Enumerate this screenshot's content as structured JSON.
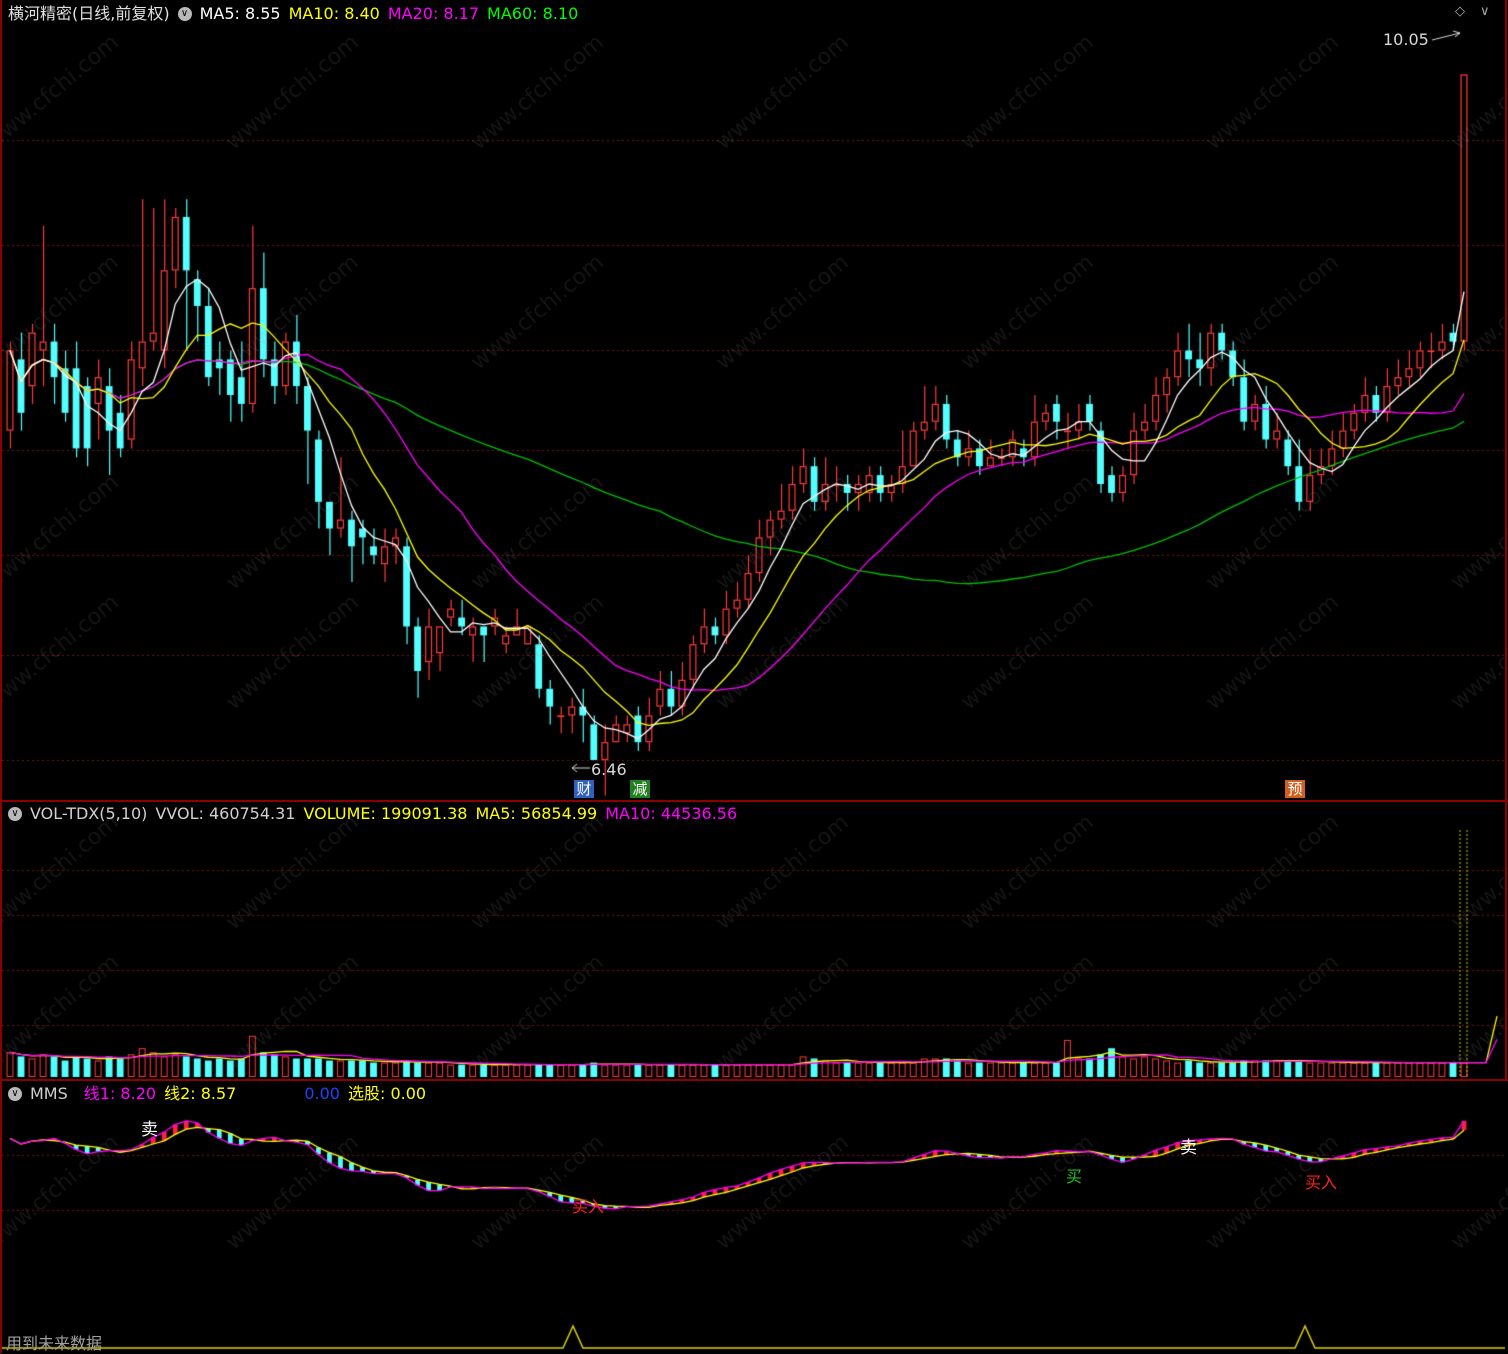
{
  "main_panel": {
    "title": "横河精密(日线,前复权)",
    "indicators": [
      {
        "label": "MA5: 8.55",
        "color": "#ffffff"
      },
      {
        "label": "MA10: 8.40",
        "color": "#ffff00"
      },
      {
        "label": "MA20: 8.17",
        "color": "#ff00ff"
      },
      {
        "label": "MA60: 8.10",
        "color": "#00ff00"
      }
    ],
    "high_label": "10.05",
    "low_label": "6.46",
    "badges": [
      {
        "text": "财",
        "bg": "#3060c0"
      },
      {
        "text": "减",
        "bg": "#208020"
      },
      {
        "text": "预",
        "bg": "#d06020"
      }
    ]
  },
  "vol_panel": {
    "name": "VOL-TDX(5,10)",
    "items": [
      {
        "label": "VVOL: 460754.31",
        "color": "#d0d0d0"
      },
      {
        "label": "VOLUME: 199091.38",
        "color": "#ffff00"
      },
      {
        "label": "MA5: 56854.99",
        "color": "#ffff00"
      },
      {
        "label": "MA10: 44536.56",
        "color": "#ff00ff"
      }
    ]
  },
  "mms_panel": {
    "name": "MMS",
    "items": [
      {
        "label": "线1: 8.20",
        "color": "#ff00ff"
      },
      {
        "label": "线2: 8.57",
        "color": "#ffff00"
      },
      {
        "label": "0.00",
        "color": "#0000ff"
      },
      {
        "label": "选股: 0.00",
        "color": "#ffff00"
      }
    ],
    "sell_label": "卖",
    "buy_label": "买入",
    "buy_short": "买",
    "footer": "用到未来数据"
  },
  "watermark": "www.cfchi.com",
  "colors": {
    "up": "#ff3b3b",
    "down": "#54ffff",
    "ma5": "#ffffff",
    "ma10": "#ffff00",
    "ma20": "#ff00ff",
    "ma60": "#00c000",
    "border": "#8b0000",
    "grid": "#7a1010"
  },
  "chart_data": {
    "type": "candlestick",
    "ylim": [
      6.2,
      10.3
    ],
    "candles": [
      [
        8.05,
        8.5,
        8.55,
        7.95
      ],
      [
        8.45,
        8.15,
        8.6,
        8.05
      ],
      [
        8.3,
        8.6,
        8.65,
        8.2
      ],
      [
        8.5,
        8.55,
        9.2,
        8.3
      ],
      [
        8.55,
        8.35,
        8.65,
        8.2
      ],
      [
        8.4,
        8.15,
        8.5,
        8.1
      ],
      [
        8.4,
        7.95,
        8.55,
        7.9
      ],
      [
        8.3,
        7.95,
        8.35,
        7.85
      ],
      [
        8.2,
        8.35,
        8.45,
        8.0
      ],
      [
        8.3,
        8.05,
        8.4,
        7.8
      ],
      [
        8.15,
        7.95,
        8.25,
        7.9
      ],
      [
        8.0,
        8.45,
        8.55,
        7.95
      ],
      [
        8.4,
        8.55,
        9.35,
        8.3
      ],
      [
        8.55,
        8.6,
        9.3,
        8.5
      ],
      [
        8.5,
        8.95,
        9.35,
        8.4
      ],
      [
        8.95,
        9.25,
        9.3,
        8.85
      ],
      [
        9.25,
        8.95,
        9.35,
        8.5
      ],
      [
        8.9,
        8.75,
        8.95,
        8.55
      ],
      [
        8.75,
        8.35,
        8.85,
        8.3
      ],
      [
        8.45,
        8.4,
        8.55,
        8.25
      ],
      [
        8.45,
        8.25,
        8.5,
        8.1
      ],
      [
        8.35,
        8.2,
        8.55,
        8.1
      ],
      [
        8.2,
        8.85,
        9.2,
        8.15
      ],
      [
        8.85,
        8.45,
        9.05,
        8.35
      ],
      [
        8.45,
        8.3,
        8.55,
        8.2
      ],
      [
        8.3,
        8.55,
        8.6,
        8.25
      ],
      [
        8.55,
        8.3,
        8.7,
        8.2
      ],
      [
        8.3,
        8.05,
        8.35,
        7.75
      ],
      [
        8.0,
        7.65,
        8.05,
        7.5
      ],
      [
        7.65,
        7.5,
        7.65,
        7.35
      ],
      [
        7.5,
        7.55,
        7.9,
        7.45
      ],
      [
        7.55,
        7.4,
        7.6,
        7.2
      ],
      [
        7.5,
        7.45,
        7.55,
        7.3
      ],
      [
        7.4,
        7.35,
        7.5,
        7.3
      ],
      [
        7.3,
        7.4,
        7.5,
        7.2
      ],
      [
        7.4,
        7.45,
        7.5,
        7.3
      ],
      [
        7.4,
        6.95,
        7.45,
        6.85
      ],
      [
        6.95,
        6.7,
        7.0,
        6.55
      ],
      [
        6.75,
        6.95,
        7.05,
        6.65
      ],
      [
        6.8,
        6.95,
        6.95,
        6.7
      ],
      [
        7.0,
        7.05,
        7.1,
        6.95
      ],
      [
        7.0,
        6.95,
        7.1,
        6.9
      ],
      [
        6.9,
        6.95,
        7.0,
        6.75
      ],
      [
        6.95,
        6.9,
        6.95,
        6.75
      ],
      [
        6.95,
        7.0,
        7.05,
        6.9
      ],
      [
        6.85,
        6.9,
        6.95,
        6.8
      ],
      [
        6.9,
        6.95,
        7.05,
        6.9
      ],
      [
        6.85,
        6.95,
        6.95,
        6.85
      ],
      [
        6.85,
        6.6,
        6.9,
        6.55
      ],
      [
        6.6,
        6.5,
        6.65,
        6.4
      ],
      [
        6.45,
        6.45,
        6.5,
        6.35
      ],
      [
        6.45,
        6.5,
        6.55,
        6.35
      ],
      [
        6.5,
        6.45,
        6.6,
        6.3
      ],
      [
        6.4,
        6.2,
        6.45,
        6.2
      ],
      [
        6.2,
        6.3,
        6.4,
        6.0
      ],
      [
        6.3,
        6.4,
        6.45,
        6.3
      ],
      [
        6.35,
        6.4,
        6.45,
        6.3
      ],
      [
        6.45,
        6.3,
        6.5,
        6.25
      ],
      [
        6.3,
        6.45,
        6.55,
        6.25
      ],
      [
        6.5,
        6.6,
        6.7,
        6.45
      ],
      [
        6.6,
        6.5,
        6.7,
        6.45
      ],
      [
        6.5,
        6.65,
        6.75,
        6.45
      ],
      [
        6.65,
        6.85,
        6.9,
        6.6
      ],
      [
        6.85,
        6.95,
        7.05,
        6.8
      ],
      [
        6.95,
        6.9,
        7.0,
        6.85
      ],
      [
        6.9,
        7.05,
        7.15,
        6.85
      ],
      [
        7.05,
        7.1,
        7.2,
        7.0
      ],
      [
        7.1,
        7.25,
        7.35,
        7.05
      ],
      [
        7.25,
        7.45,
        7.55,
        7.2
      ],
      [
        7.45,
        7.55,
        7.6,
        7.35
      ],
      [
        7.55,
        7.6,
        7.75,
        7.5
      ],
      [
        7.6,
        7.75,
        7.85,
        7.55
      ],
      [
        7.75,
        7.85,
        7.95,
        7.7
      ],
      [
        7.85,
        7.65,
        7.9,
        7.6
      ],
      [
        7.65,
        7.75,
        7.9,
        7.6
      ],
      [
        7.75,
        7.75,
        7.85,
        7.65
      ],
      [
        7.75,
        7.7,
        7.8,
        7.6
      ],
      [
        7.7,
        7.75,
        7.8,
        7.6
      ],
      [
        7.7,
        7.8,
        7.85,
        7.65
      ],
      [
        7.8,
        7.7,
        7.85,
        7.65
      ],
      [
        7.7,
        7.75,
        7.8,
        7.65
      ],
      [
        7.75,
        7.85,
        8.05,
        7.7
      ],
      [
        7.85,
        8.05,
        8.1,
        7.85
      ],
      [
        8.05,
        8.1,
        8.3,
        8.0
      ],
      [
        8.1,
        8.2,
        8.3,
        8.05
      ],
      [
        8.2,
        8.0,
        8.25,
        7.95
      ],
      [
        8.0,
        7.9,
        8.05,
        7.85
      ],
      [
        7.9,
        7.95,
        8.05,
        7.85
      ],
      [
        7.95,
        7.85,
        8.0,
        7.8
      ],
      [
        7.85,
        7.9,
        8.0,
        7.85
      ],
      [
        7.9,
        7.9,
        7.95,
        7.85
      ],
      [
        7.9,
        8.0,
        8.05,
        7.85
      ],
      [
        7.95,
        7.9,
        8.0,
        7.85
      ],
      [
        7.9,
        8.1,
        8.25,
        7.85
      ],
      [
        8.1,
        8.15,
        8.2,
        8.05
      ],
      [
        8.2,
        8.1,
        8.25,
        8.0
      ],
      [
        8.05,
        8.05,
        8.15,
        7.95
      ],
      [
        8.05,
        8.1,
        8.2,
        8.0
      ],
      [
        8.2,
        8.1,
        8.25,
        8.05
      ],
      [
        8.05,
        7.75,
        8.1,
        7.7
      ],
      [
        7.8,
        7.7,
        7.85,
        7.65
      ],
      [
        7.7,
        7.8,
        7.85,
        7.65
      ],
      [
        7.8,
        8.05,
        8.15,
        7.75
      ],
      [
        8.05,
        8.1,
        8.2,
        8.0
      ],
      [
        8.1,
        8.25,
        8.35,
        8.05
      ],
      [
        8.25,
        8.35,
        8.4,
        8.15
      ],
      [
        8.35,
        8.5,
        8.6,
        8.3
      ],
      [
        8.5,
        8.45,
        8.65,
        8.35
      ],
      [
        8.45,
        8.4,
        8.6,
        8.3
      ],
      [
        8.4,
        8.6,
        8.65,
        8.3
      ],
      [
        8.6,
        8.5,
        8.65,
        8.45
      ],
      [
        8.5,
        8.35,
        8.55,
        8.3
      ],
      [
        8.35,
        8.1,
        8.45,
        8.05
      ],
      [
        8.1,
        8.2,
        8.25,
        8.05
      ],
      [
        8.2,
        8.0,
        8.3,
        7.95
      ],
      [
        8.0,
        8.05,
        8.15,
        7.95
      ],
      [
        8.0,
        7.85,
        8.05,
        7.8
      ],
      [
        7.85,
        7.65,
        8.0,
        7.6
      ],
      [
        7.65,
        7.8,
        7.95,
        7.6
      ],
      [
        7.8,
        7.85,
        7.95,
        7.75
      ],
      [
        7.85,
        7.95,
        8.05,
        7.8
      ],
      [
        7.95,
        8.05,
        8.15,
        7.9
      ],
      [
        8.05,
        8.15,
        8.2,
        8.0
      ],
      [
        8.15,
        8.25,
        8.35,
        8.1
      ],
      [
        8.25,
        8.15,
        8.3,
        8.1
      ],
      [
        8.15,
        8.3,
        8.4,
        8.1
      ],
      [
        8.3,
        8.35,
        8.45,
        8.25
      ],
      [
        8.35,
        8.4,
        8.5,
        8.3
      ],
      [
        8.4,
        8.5,
        8.55,
        8.35
      ],
      [
        8.5,
        8.5,
        8.6,
        8.4
      ],
      [
        8.5,
        8.55,
        8.65,
        8.45
      ],
      [
        8.6,
        8.55,
        8.65,
        8.5
      ],
      [
        8.55,
        10.05,
        10.05,
        8.5
      ]
    ],
    "volume_rel": [
      0.6,
      0.5,
      0.45,
      0.55,
      0.5,
      0.4,
      0.5,
      0.45,
      0.4,
      0.5,
      0.45,
      0.55,
      0.7,
      0.6,
      0.5,
      0.55,
      0.5,
      0.45,
      0.4,
      0.45,
      0.4,
      0.45,
      1.0,
      0.6,
      0.55,
      0.5,
      0.45,
      0.45,
      0.45,
      0.4,
      0.4,
      0.4,
      0.4,
      0.35,
      0.35,
      0.35,
      0.4,
      0.35,
      0.35,
      0.35,
      0.3,
      0.3,
      0.3,
      0.3,
      0.3,
      0.3,
      0.3,
      0.3,
      0.3,
      0.3,
      0.3,
      0.3,
      0.3,
      0.35,
      0.3,
      0.3,
      0.3,
      0.3,
      0.3,
      0.3,
      0.3,
      0.3,
      0.3,
      0.3,
      0.3,
      0.3,
      0.3,
      0.3,
      0.3,
      0.3,
      0.3,
      0.3,
      0.5,
      0.45,
      0.4,
      0.35,
      0.35,
      0.35,
      0.35,
      0.35,
      0.35,
      0.35,
      0.35,
      0.45,
      0.45,
      0.45,
      0.4,
      0.35,
      0.35,
      0.35,
      0.35,
      0.35,
      0.35,
      0.35,
      0.35,
      0.35,
      0.9,
      0.45,
      0.45,
      0.55,
      0.7,
      0.5,
      0.45,
      0.5,
      0.45,
      0.4,
      0.35,
      0.4,
      0.35,
      0.35,
      0.35,
      0.35,
      0.4,
      0.4,
      0.4,
      0.4,
      0.4,
      0.4,
      0.35,
      0.35,
      0.35,
      0.35,
      0.35,
      0.35,
      0.35,
      0.35,
      0.35,
      0.35,
      0.35,
      0.35,
      0.35,
      0.35,
      0.35,
      0.35,
      0.35,
      6.0
    ]
  }
}
